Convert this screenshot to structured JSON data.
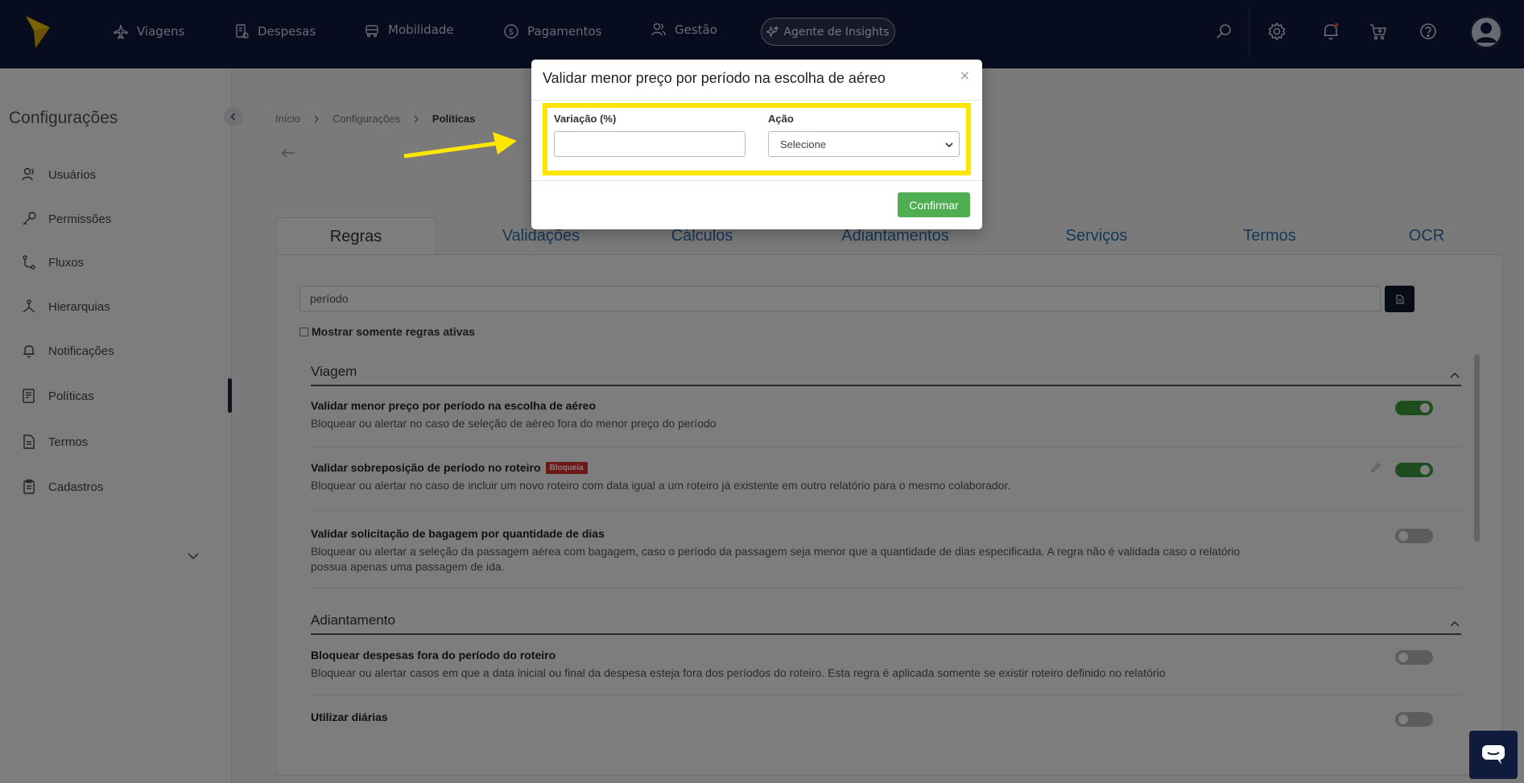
{
  "nav": {
    "items": [
      {
        "label": "Viagens",
        "icon": "plane-icon"
      },
      {
        "label": "Despesas",
        "icon": "receipt-icon"
      },
      {
        "label": "Mobilidade",
        "icon": "car-icon"
      },
      {
        "label": "Pagamentos",
        "icon": "dollar-icon"
      },
      {
        "label": "Gestão",
        "icon": "users-icon"
      }
    ],
    "agent_label": "Agente de Insights"
  },
  "sidebar": {
    "title": "Configurações",
    "items": [
      {
        "label": "Usuários",
        "icon": "users-icon"
      },
      {
        "label": "Permissões",
        "icon": "key-icon"
      },
      {
        "label": "Fluxos",
        "icon": "flow-icon"
      },
      {
        "label": "Hierarquias",
        "icon": "hierarchy-icon"
      },
      {
        "label": "Notificações",
        "icon": "bell-icon"
      },
      {
        "label": "Políticas",
        "icon": "policy-icon"
      },
      {
        "label": "Termos",
        "icon": "document-icon"
      },
      {
        "label": "Cadastros",
        "icon": "clipboard-icon"
      }
    ]
  },
  "breadcrumb": [
    "Início",
    "Configurações",
    "Políticas"
  ],
  "tabs": [
    "Regras",
    "Validações",
    "Cálculos",
    "Adiantamentos",
    "Serviços",
    "Termos",
    "OCR"
  ],
  "search": {
    "value": "período"
  },
  "active_only_label": "Mostrar somente regras ativas",
  "sections": [
    {
      "title": "Viagem",
      "rules": [
        {
          "title": "Validar menor preço por período na escolha de aéreo",
          "desc": "Bloquear ou alertar no caso de seleção de aéreo fora do menor preço do período",
          "enabled": true
        },
        {
          "title": "Validar sobreposição de período no roteiro",
          "badge": "Bloqueia",
          "desc": "Bloquear ou alertar no caso de incluir um novo roteiro com data igual a um roteiro já existente em outro relatório para o mesmo colaborador.",
          "enabled": true
        },
        {
          "title": "Validar solicitação de bagagem por quantidade de dias",
          "desc": "Bloquear ou alertar a seleção da passagem aérea com bagagem, caso o período da passagem seja menor que a quantidade de dias especificada. A regra não é validada caso o relatório possua apenas uma passagem de ida.",
          "enabled": false
        }
      ]
    },
    {
      "title": "Adiantamento",
      "rules": [
        {
          "title": "Bloquear despesas fora do período do roteiro",
          "desc": "Bloquear ou alertar casos em que a data inicial ou final da despesa esteja fora dos períodos do roteiro. Esta regra é aplicada somente se existir roteiro definido no relatório",
          "enabled": false
        },
        {
          "title": "Utilizar diárias",
          "enabled": false
        }
      ]
    }
  ],
  "modal": {
    "title": "Validar menor preço por período na escolha de aéreo",
    "close": "×",
    "variation_label": "Variação (%)",
    "variation_value": "",
    "action_label": "Ação",
    "action_selected": "Selecione",
    "confirm_label": "Confirmar"
  },
  "colors": {
    "navbar": "#0e1b3d",
    "highlight": "#ffe600",
    "confirm": "#4fae52",
    "toggle_on": "#3d9b3f",
    "badge": "#d9312e",
    "tab_link": "#2c6fae"
  }
}
